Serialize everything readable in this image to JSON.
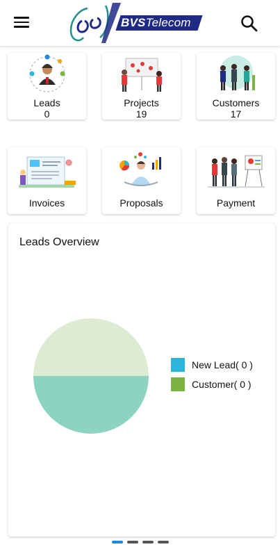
{
  "header": {
    "brand_bold": "BVS",
    "brand_rest": "Telecom",
    "menu_icon": "hamburger-menu-icon",
    "search_icon": "search-icon"
  },
  "tiles": [
    {
      "label": "Leads",
      "count": "0",
      "icon": "leads-illustration"
    },
    {
      "label": "Projects",
      "count": "19",
      "icon": "projects-illustration"
    },
    {
      "label": "Customers",
      "count": "17",
      "icon": "customers-illustration"
    },
    {
      "label": "Invoices",
      "icon": "invoices-illustration"
    },
    {
      "label": "Proposals",
      "icon": "proposals-illustration"
    },
    {
      "label": "Payment",
      "icon": "payment-illustration"
    }
  ],
  "leads_overview": {
    "title": "Leads Overview",
    "legend": [
      {
        "label": "New Lead( 0 )",
        "color": "#29b6d9"
      },
      {
        "label": "Customer( 0 )",
        "color": "#7cb342"
      }
    ]
  },
  "chart_data": {
    "type": "pie",
    "title": "Leads Overview",
    "categories": [
      "New Lead",
      "Customer"
    ],
    "values": [
      0,
      0
    ],
    "legend": "right",
    "rendered_fill_colors": [
      "#dcebd1",
      "#8dd3c2"
    ]
  },
  "pager": {
    "pages": 4,
    "active": 0
  },
  "colors": {
    "accent": "#1e88e5",
    "brand_navy": "#1f2a86"
  }
}
